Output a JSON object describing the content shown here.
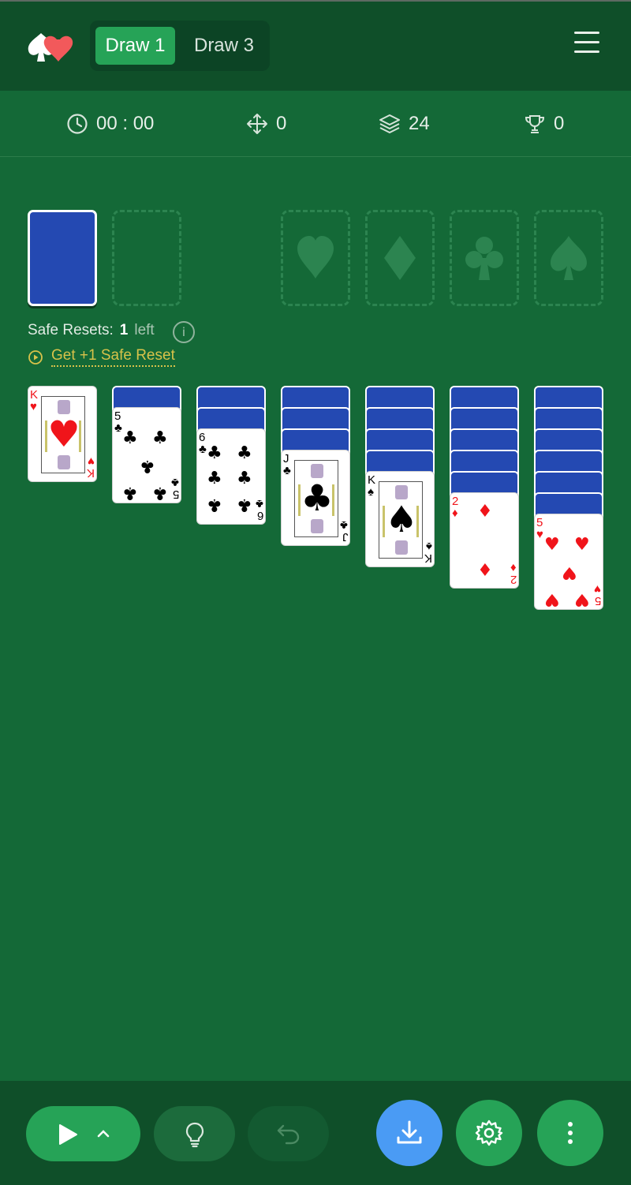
{
  "header": {
    "draw1_label": "Draw 1",
    "draw3_label": "Draw 3",
    "active_mode": "Draw 1"
  },
  "stats": {
    "time": "00 : 00",
    "moves": "0",
    "stock_count": "24",
    "score": "0"
  },
  "foundations": [
    "hearts",
    "diamonds",
    "clubs",
    "spades"
  ],
  "safe_resets": {
    "label": "Safe Resets:",
    "count": "1",
    "suffix": "left",
    "info": "i",
    "get_more": "Get +1 Safe Reset"
  },
  "tableau": [
    {
      "hidden": 0,
      "rank": "K",
      "suit": "hearts",
      "suit_glyph": "♥"
    },
    {
      "hidden": 1,
      "rank": "5",
      "suit": "clubs",
      "suit_glyph": "♣"
    },
    {
      "hidden": 2,
      "rank": "6",
      "suit": "clubs",
      "suit_glyph": "♣"
    },
    {
      "hidden": 3,
      "rank": "J",
      "suit": "clubs",
      "suit_glyph": "♣"
    },
    {
      "hidden": 4,
      "rank": "K",
      "suit": "spades",
      "suit_glyph": "♠"
    },
    {
      "hidden": 5,
      "rank": "2",
      "suit": "diamonds",
      "suit_glyph": "♦"
    },
    {
      "hidden": 6,
      "rank": "5",
      "suit": "hearts",
      "suit_glyph": "♥"
    }
  ],
  "colors": {
    "felt": "#146937",
    "bar": "#0f4f29",
    "accent_green": "#26a357",
    "card_back": "#2449b2",
    "download_blue": "#4a9bf4",
    "gold_link": "#d7c24a"
  }
}
